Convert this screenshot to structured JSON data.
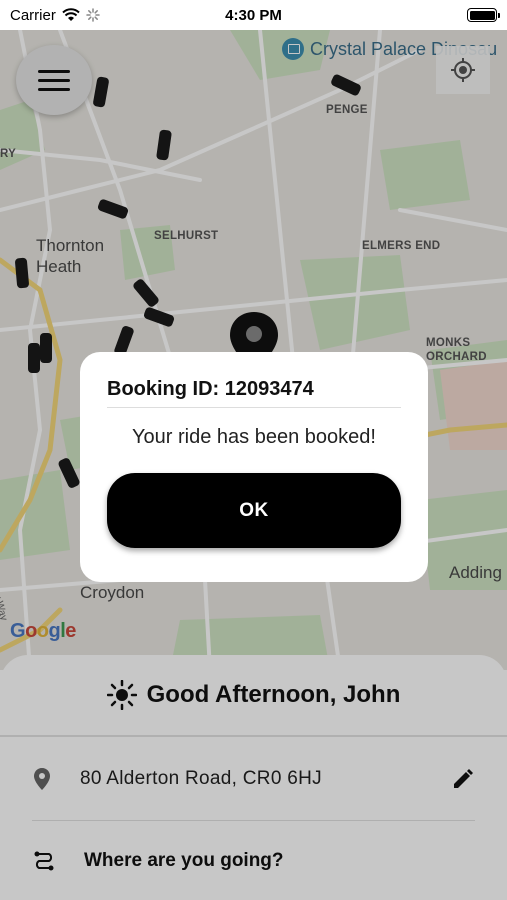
{
  "status_bar": {
    "carrier": "Carrier",
    "time": "4:30 PM"
  },
  "map": {
    "labels": {
      "crystal_palace": "Crystal Palace Dinosau",
      "penge": "PENGE",
      "ry": "RY",
      "thornton_heath": "Thornton\nHeath",
      "selhurst": "SELHURST",
      "elmers_end": "ELMERS END",
      "monks_orchard": "MONKS\nORCHARD",
      "croydon": "Croydon",
      "adding": "Adding",
      "purley_way": "Purley Way"
    },
    "google_logo": "Google"
  },
  "dialog": {
    "title": "Booking ID: 12093474",
    "message": "Your ride has been booked!",
    "ok_label": "OK"
  },
  "sheet": {
    "greeting": "Good Afternoon, John",
    "address": "80 Alderton Road, CR0 6HJ",
    "destination_prompt": "Where are you going?"
  },
  "colors": {
    "accent": "#000000",
    "map_background": "#e8e6e0",
    "park_green": "#cfe3c3",
    "road_yellow": "#f3d77a"
  },
  "icons": {
    "menu": "hamburger-icon",
    "locate": "crosshair-icon",
    "pin": "map-pin-icon",
    "greeting": "sun-icon",
    "address": "location-pin-icon",
    "edit": "pencil-icon",
    "route": "route-icon"
  }
}
